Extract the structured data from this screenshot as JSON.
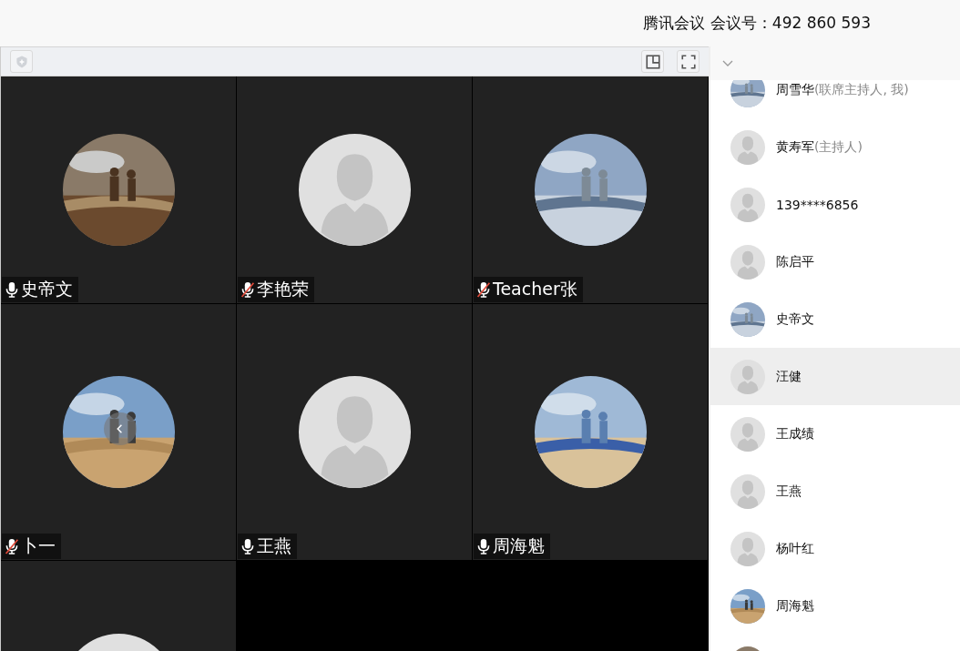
{
  "header": {
    "title": "腾讯会议 会议号：492 860 593"
  },
  "video_tiles": [
    {
      "name": "史帝文",
      "muted": false,
      "kind": "picture"
    },
    {
      "name": "李艳荣",
      "muted": true,
      "kind": "default"
    },
    {
      "name": "Teacher张",
      "muted": true,
      "kind": "picture"
    },
    {
      "name": "卜一",
      "muted": true,
      "kind": "picture",
      "carousel_arrow": true
    },
    {
      "name": "王燕",
      "muted": false,
      "kind": "default"
    },
    {
      "name": "周海魁",
      "muted": false,
      "kind": "picture"
    },
    {
      "kind": "default"
    }
  ],
  "participants": [
    {
      "name": "周雪华",
      "role": "(联席主持人, 我)",
      "kind": "picture",
      "selected": false
    },
    {
      "name": "黄寿军",
      "role": "(主持人)",
      "kind": "default",
      "selected": false
    },
    {
      "name": "139****6856",
      "kind": "default",
      "selected": false
    },
    {
      "name": "陈启平",
      "kind": "default",
      "selected": false
    },
    {
      "name": "史帝文",
      "kind": "picture",
      "selected": false
    },
    {
      "name": "汪健",
      "kind": "default",
      "selected": true
    },
    {
      "name": "王成绩",
      "kind": "default",
      "selected": false
    },
    {
      "name": "王燕",
      "kind": "default",
      "selected": false
    },
    {
      "name": "杨叶红",
      "kind": "default",
      "selected": false
    },
    {
      "name": "周海魁",
      "kind": "picture",
      "selected": false
    },
    {
      "kind": "picture",
      "selected": false
    }
  ]
}
